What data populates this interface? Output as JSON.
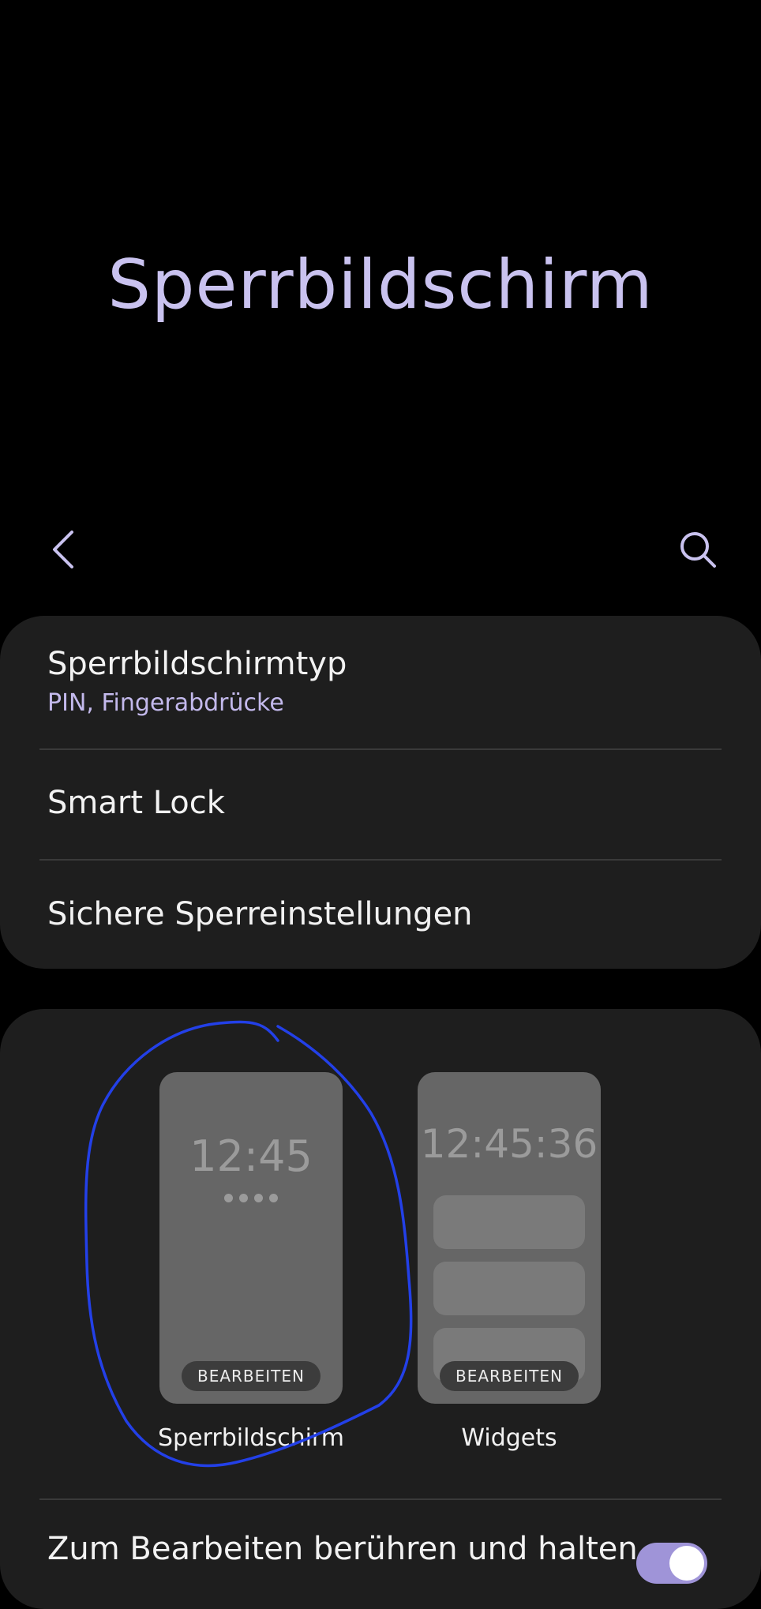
{
  "header": {
    "title": "Sperrbildschirm"
  },
  "toolbar": {
    "back_icon": "chevron-left-icon",
    "search_icon": "search-icon"
  },
  "security_card": {
    "lock_type": {
      "title": "Sperrbildschirmtyp",
      "subtitle": "PIN, Fingerabdrücke"
    },
    "smart_lock": {
      "title": "Smart Lock"
    },
    "secure_lock_settings": {
      "title": "Sichere Sperreinstellungen"
    }
  },
  "customize_card": {
    "lock_screen_preview": {
      "clock": "12:45",
      "edit_label": "BEARBEITEN",
      "label": "Sperrbildschirm"
    },
    "widgets_preview": {
      "clock": "12:45:36",
      "edit_label": "BEARBEITEN",
      "label": "Widgets"
    },
    "touch_hold_toggle": {
      "title": "Zum Bearbeiten berühren und halten",
      "enabled": true
    }
  },
  "colors": {
    "accent": "#c9c2ef",
    "card": "#1e1e1e",
    "annotation": "#2340e8",
    "toggle_on": "#9f94d8"
  }
}
